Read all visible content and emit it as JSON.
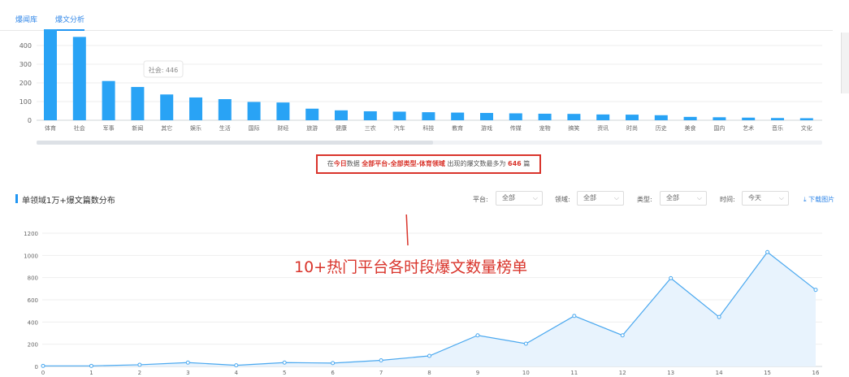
{
  "tabs": [
    {
      "label": "爆闻库"
    },
    {
      "label": "爆文分析"
    }
  ],
  "bar_tooltip": "社会: 446",
  "notice": {
    "prefix": "在",
    "today": "今日",
    "mid": "数据",
    "filter": "全部平台-全部类型-体育领域",
    "mid2": "出现的爆文数最多为",
    "count": "646",
    "suffix": "篇"
  },
  "section": {
    "title": "单领域1万+爆文篇数分布"
  },
  "filters": {
    "platform_label": "平台:",
    "platform_value": "全部",
    "domain_label": "领域:",
    "domain_value": "全部",
    "type_label": "类型:",
    "type_value": "全部",
    "time_label": "时间:",
    "time_value": "今天",
    "download_label": "⤓ 下载图片"
  },
  "annotation": {
    "text": "10+热门平台各时段爆文数量榜单"
  },
  "colors": {
    "accent": "#2196f3",
    "bar": "#29a3f5",
    "line": "#4aa8ef",
    "area": "#e8f3fd",
    "annotation": "#d9342b"
  },
  "chart_data": [
    {
      "type": "bar",
      "categories": [
        "体育",
        "社会",
        "军事",
        "新闻",
        "其它",
        "娱乐",
        "生活",
        "国际",
        "财经",
        "旅游",
        "健康",
        "三农",
        "汽车",
        "科技",
        "教育",
        "游戏",
        "传媒",
        "宠物",
        "搞笑",
        "资讯",
        "时尚",
        "历史",
        "美食",
        "国内",
        "艺术",
        "音乐",
        "文化"
      ],
      "values": [
        490,
        446,
        210,
        178,
        138,
        122,
        113,
        98,
        95,
        62,
        53,
        48,
        46,
        43,
        41,
        39,
        37,
        35,
        34,
        31,
        30,
        27,
        18,
        16,
        14,
        12,
        11
      ],
      "y_ticks": [
        0,
        100,
        200,
        300,
        400
      ],
      "ylim": [
        0,
        500
      ],
      "grid": true
    },
    {
      "type": "area",
      "x": [
        0,
        1,
        2,
        3,
        4,
        5,
        6,
        7,
        8,
        9,
        10,
        11,
        12,
        13,
        14,
        15,
        16
      ],
      "values": [
        5,
        5,
        15,
        35,
        10,
        35,
        30,
        55,
        95,
        280,
        205,
        455,
        280,
        795,
        445,
        1030,
        690
      ],
      "y_ticks": [
        0,
        200,
        400,
        600,
        800,
        1000,
        1200
      ],
      "ylim": [
        0,
        1200
      ],
      "grid": true
    }
  ]
}
